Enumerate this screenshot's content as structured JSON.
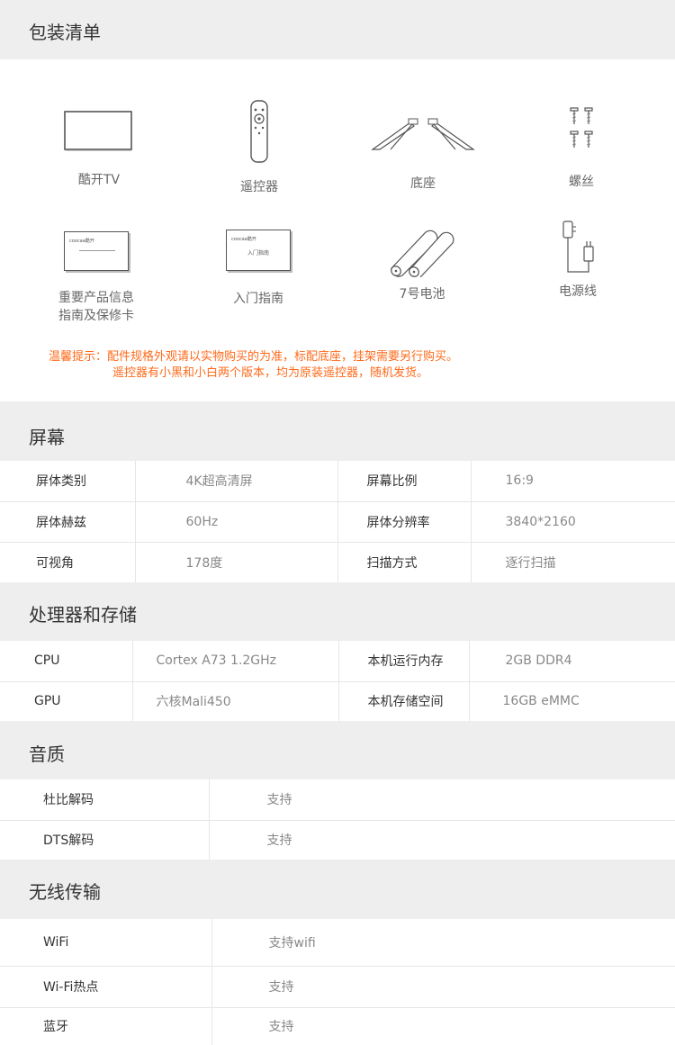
{
  "package": {
    "title": "包装清单",
    "items": [
      {
        "label": "酷开TV",
        "icon": "tv-icon"
      },
      {
        "label": "遥控器",
        "icon": "remote-icon"
      },
      {
        "label": "底座",
        "icon": "stand-icon"
      },
      {
        "label": "螺丝",
        "icon": "screws-icon"
      },
      {
        "label": "重要产品信息",
        "label2": "指南及保修卡",
        "icon": "warranty-card-icon",
        "card_text": "coocaa酷开"
      },
      {
        "label": "入门指南",
        "icon": "guide-icon",
        "card_text": "coocaa酷开",
        "card_text2": "入门指南"
      },
      {
        "label": "7号电池",
        "icon": "battery-icon"
      },
      {
        "label": "电源线",
        "icon": "power-cord-icon"
      }
    ],
    "notice_line1": "温馨提示：配件规格外观请以实物购买的为准，标配底座，挂架需要另行购买。",
    "notice_line2": "遥控器有小黑和小白两个版本，均为原装遥控器，随机发货。"
  },
  "screen": {
    "title": "屏幕",
    "rows": [
      [
        "屏体类别",
        "4K超高清屏",
        "屏幕比例",
        "16:9"
      ],
      [
        "屏体赫兹",
        "60Hz",
        "屏体分辨率",
        "3840*2160"
      ],
      [
        "可视角",
        "178度",
        "扫描方式",
        "逐行扫描"
      ]
    ]
  },
  "processor": {
    "title": "处理器和存储",
    "rows": [
      [
        "CPU",
        "Cortex A73 1.2GHz",
        "本机运行内存",
        "2GB DDR4"
      ],
      [
        "GPU",
        "六核Mali450",
        "本机存储空间",
        "16GB eMMC"
      ]
    ]
  },
  "audio": {
    "title": "音质",
    "rows": [
      [
        "杜比解码",
        "支持"
      ],
      [
        "DTS解码",
        "支持"
      ]
    ]
  },
  "wireless": {
    "title": "无线传输",
    "rows": [
      [
        "WiFi",
        "支持wifi"
      ],
      [
        "Wi-Fi热点",
        "支持"
      ],
      [
        "蓝牙",
        "支持"
      ]
    ]
  },
  "colors": {
    "section_bg": "#eeeeee",
    "notice": "#ff6a1a",
    "border": "#e6e6e6"
  }
}
